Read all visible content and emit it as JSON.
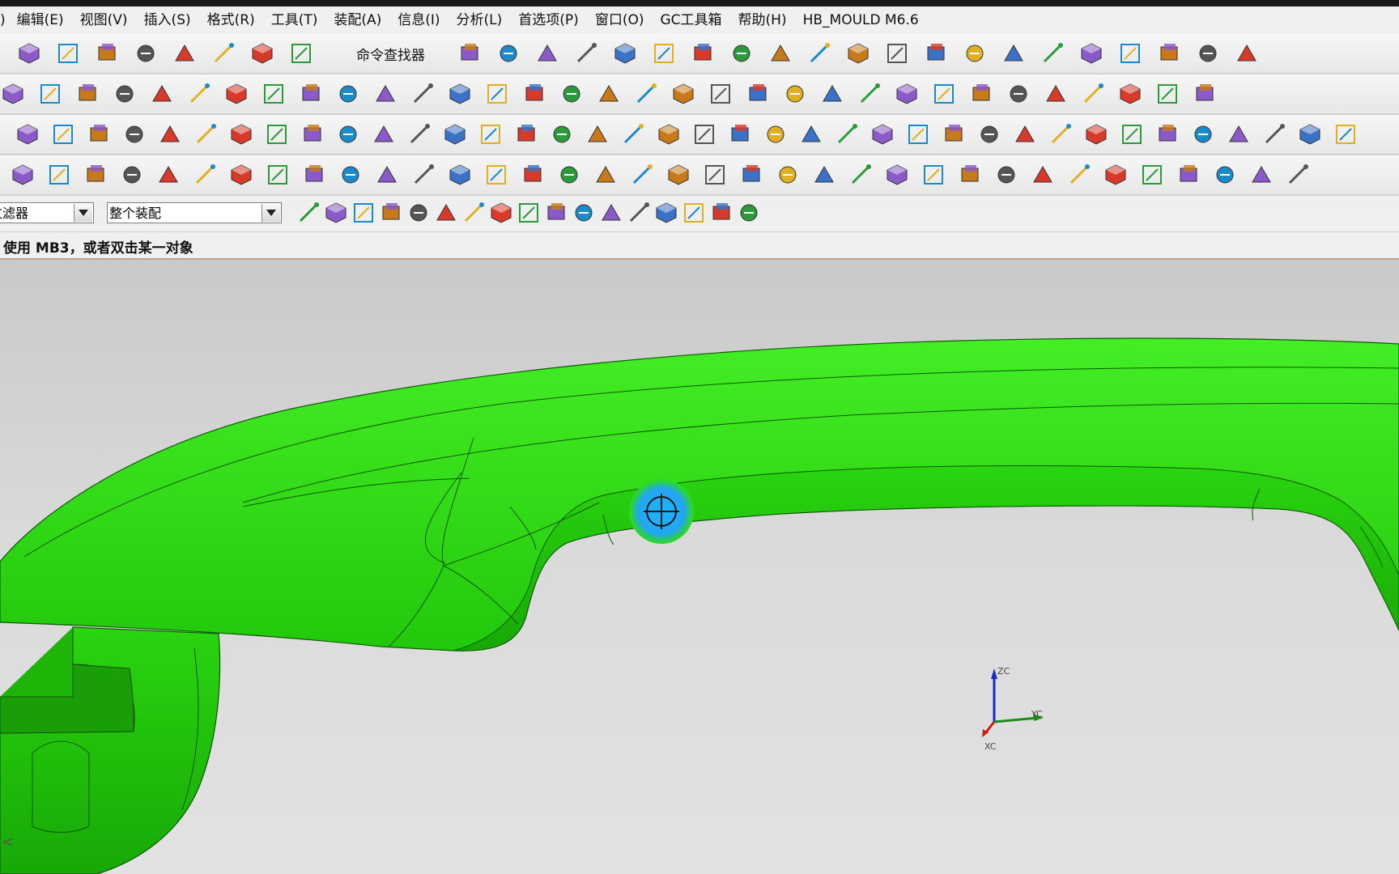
{
  "menu": [
    "编辑(E)",
    "视图(V)",
    "插入(S)",
    "格式(R)",
    "工具(T)",
    "装配(A)",
    "信息(I)",
    "分析(L)",
    "首选项(P)",
    "窗口(O)",
    "GC工具箱",
    "帮助(H)",
    "HB_MOULD M6.6"
  ],
  "menu_left_fragment": ")",
  "toolbar": {
    "command_finder_label": "命令查找器"
  },
  "selection_bar": {
    "filter_value": "过滤器",
    "scope_value": "整个装配"
  },
  "status_bar": {
    "prompt": "使用 MB3，或者双击某一对象"
  },
  "viewport": {
    "part_color": "#2fdd12",
    "background_top": "#c9c9c9",
    "background_bottom": "#e2e2e2",
    "axes": {
      "z_label": "ZC",
      "y_label": "YC",
      "x_label": "XC"
    },
    "cursor": "crosshair-highlight-icon"
  },
  "icons": {
    "row1": [
      "new-file-icon",
      "open-folder-icon",
      "save-icon",
      "cut-icon",
      "copy-icon",
      "paste-icon",
      "undo-icon",
      "redo-icon",
      "command-finder-icon",
      "fit-view-icon",
      "render-style-icon",
      "shaded-cube-icon",
      "shade-toggle-icon",
      "section-view-icon",
      "background-icon",
      "rectangle-view-icon",
      "layer-settings-icon",
      "wcs-orient-icon",
      "wcs-origin-icon",
      "wcs-rotate-icon",
      "wcs-dynamic-icon",
      "wcs-display-icon",
      "snap-view-icon",
      "navigate-icon",
      "measure-distance-icon",
      "measure-angle-icon",
      "line-icon",
      "arc-icon",
      "spline-icon"
    ],
    "row2": [
      "extrude-icon",
      "revolve-icon",
      "cylinder-icon",
      "block-icon",
      "sphere-icon",
      "pad-icon",
      "boss-icon",
      "datum-plane-icon",
      "point-icon",
      "offset-face-icon",
      "trim-body-icon",
      "split-body-icon",
      "face-blend-icon",
      "chamfer-icon",
      "shell-icon",
      "draft-icon",
      "edge-blend-icon",
      "taper-icon",
      "unite-icon",
      "subtract-icon",
      "sew-icon",
      "ruled-surface-icon",
      "through-curves-icon",
      "mesh-surface-icon",
      "swept-icon",
      "law-extension-icon",
      "bridge-surface-icon",
      "n-sided-icon",
      "offset-surface-icon",
      "trimmed-sheet-icon",
      "curve-project-icon",
      "curve-intersect-icon",
      "curve-offset-icon"
    ],
    "row3": [
      "sketch-icon",
      "triangle-icon",
      "assembly-icon",
      "stack-icon",
      "mold-wizard-icon",
      "parting-icon",
      "runner-icon",
      "gate-icon",
      "slider-icon",
      "lifter-icon",
      "ejector-icon",
      "cooling-icon",
      "electrode-icon",
      "bom-icon",
      "workpiece-icon",
      "cavity-icon",
      "trim-tool-icon",
      "pocket-icon",
      "m-icon",
      "calculator-icon",
      "grid-icon",
      "list-icon",
      "boolean-icon",
      "angle-tool-icon",
      "clock-icon",
      "back-icon",
      "hourglass-icon",
      "mold-base-icon",
      "standard-part-icon",
      "spring-icon",
      "screw-icon",
      "pin-icon",
      "support-icon",
      "insert-icon",
      "sub-insert-icon",
      "color-icon",
      "hole-icon",
      "plane-icon"
    ],
    "row4": [
      "face-box-icon",
      "frame-icon",
      "split-face-icon",
      "palette-icon",
      "grid-select-icon",
      "line-tool-icon",
      "target-icon",
      "diagonal-icon",
      "insert-grid-icon",
      "layers-icon",
      "trim-line-icon",
      "corner-icon",
      "reflect-icon",
      "check-icon",
      "delete-icon",
      "folder-icon",
      "brush-icon",
      "move-face-icon",
      "replace-face-icon",
      "offset-region-icon",
      "parallel-icon",
      "perpendicular-icon",
      "rotate-icon",
      "resize-face-icon",
      "pattern-icon",
      "group-icon",
      "label-icon",
      "tangent-icon",
      "line-drag-icon",
      "rotate-face-icon",
      "linked-face-icon",
      "circle-pattern-icon",
      "rect-pattern-icon",
      "constraint-icon",
      "undo-rotate-icon",
      "dim-icon"
    ],
    "row5": [
      "filter-icon",
      "select-all-icon",
      "deselect-icon",
      "face-select-icon",
      "curve-select-icon",
      "box-select-icon",
      "snap-end-icon",
      "snap-mid-icon",
      "snap-control-icon",
      "snap-curve-icon",
      "snap-intersect-icon",
      "snap-center-icon",
      "snap-quadrant-icon",
      "snap-point-icon",
      "snap-on-curve-icon",
      "snap-face-icon",
      "snap-bounded-icon"
    ]
  }
}
